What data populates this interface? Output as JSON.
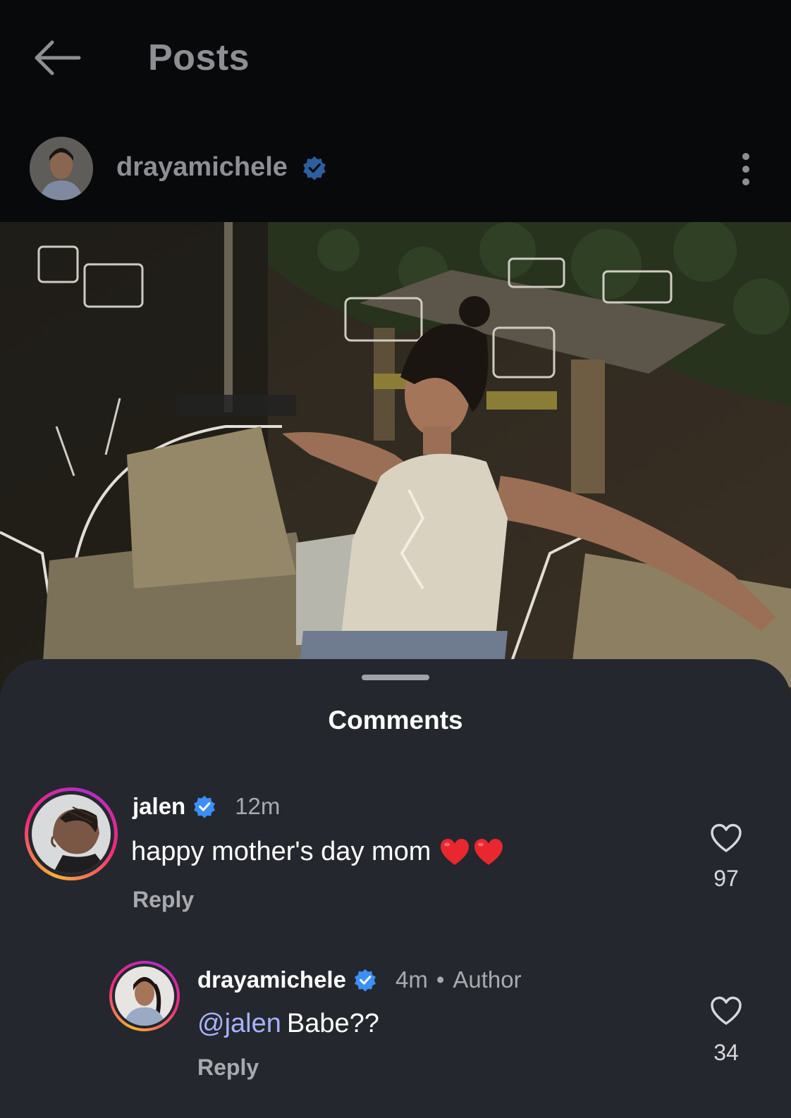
{
  "header": {
    "title": "Posts",
    "back_icon": "arrow-left-icon"
  },
  "post": {
    "username": "drayamichele",
    "verified": true,
    "more_icon": "more-vertical-icon"
  },
  "comments_sheet": {
    "title": "Comments",
    "comments": [
      {
        "username": "jalen",
        "verified": true,
        "time": "12m",
        "text": "happy mother's day mom",
        "emoji": "❤️❤️",
        "reply_label": "Reply",
        "likes": "97"
      },
      {
        "username": "drayamichele",
        "verified": true,
        "time": "4m",
        "separator": "•",
        "author_label": "Author",
        "mention": "@jalen",
        "text": "Babe??",
        "reply_label": "Reply",
        "likes": "34"
      }
    ]
  },
  "colors": {
    "background": "#000000",
    "sheet": "#24272d",
    "verified": "#3b8ff5",
    "mention": "#a8b2ff",
    "muted_text": "#a8aab0"
  }
}
